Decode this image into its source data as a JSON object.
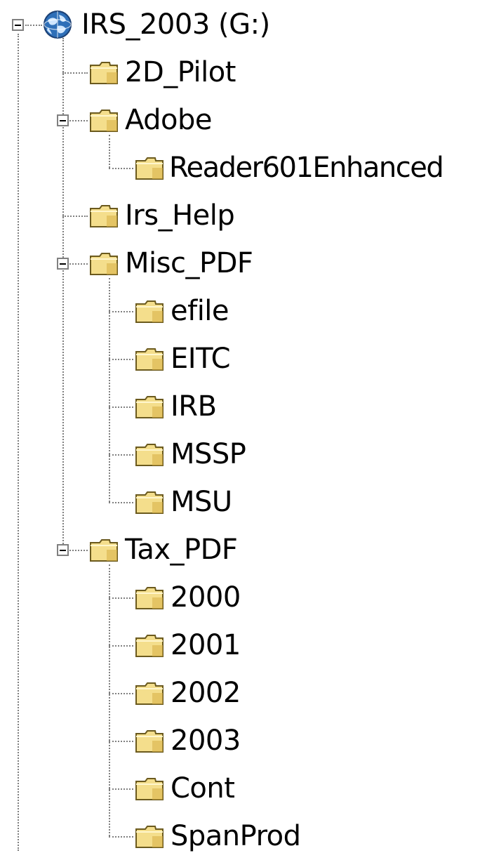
{
  "tree": {
    "root": {
      "label": "IRS_2003 (G:)",
      "icon": "network-drive-icon",
      "expanded": true
    },
    "folders": [
      {
        "label": "2D_Pilot",
        "icon": "folder-icon"
      },
      {
        "label": "Adobe",
        "icon": "folder-icon",
        "expanded": true,
        "children": [
          {
            "label": "Reader601Enhanced",
            "icon": "folder-icon"
          }
        ]
      },
      {
        "label": "Irs_Help",
        "icon": "folder-icon"
      },
      {
        "label": "Misc_PDF",
        "icon": "folder-icon",
        "expanded": true,
        "children": [
          {
            "label": "efile",
            "icon": "folder-icon"
          },
          {
            "label": "EITC",
            "icon": "folder-icon"
          },
          {
            "label": "IRB",
            "icon": "folder-icon"
          },
          {
            "label": "MSSP",
            "icon": "folder-icon"
          },
          {
            "label": "MSU",
            "icon": "folder-icon"
          }
        ]
      },
      {
        "label": "Tax_PDF",
        "icon": "folder-icon",
        "expanded": true,
        "children": [
          {
            "label": "2000",
            "icon": "folder-icon"
          },
          {
            "label": "2001",
            "icon": "folder-icon"
          },
          {
            "label": "2002",
            "icon": "folder-icon"
          },
          {
            "label": "2003",
            "icon": "folder-icon"
          },
          {
            "label": "Cont",
            "icon": "folder-icon"
          },
          {
            "label": "SpanProd",
            "icon": "folder-icon"
          }
        ]
      }
    ]
  },
  "colors": {
    "folder_fill": "#F4DE8C",
    "folder_shade": "#D9B24A",
    "folder_outline": "#6B5A1E",
    "connector": "#808080",
    "drive_blue": "#2E6FB8"
  }
}
